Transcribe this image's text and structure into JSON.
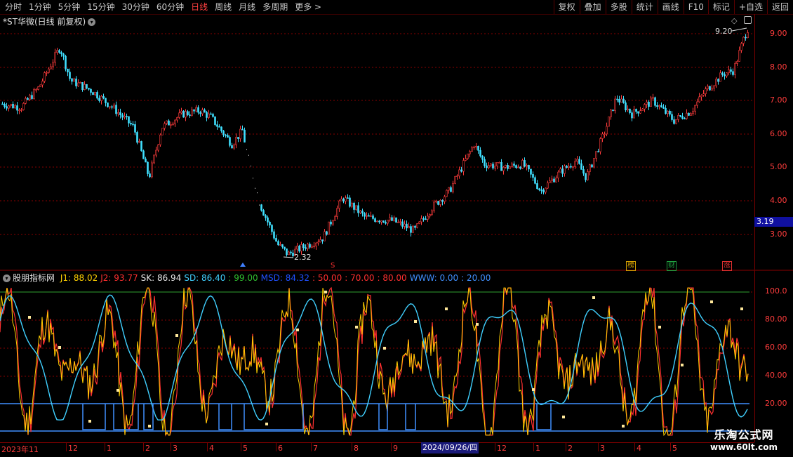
{
  "toolbar": {
    "periods": [
      "分时",
      "1分钟",
      "5分钟",
      "15分钟",
      "30分钟",
      "60分钟",
      "日线",
      "周线",
      "月线",
      "多周期",
      "更多 >"
    ],
    "active_period": "日线",
    "actions": [
      "复权",
      "叠加",
      "多股",
      "统计",
      "画线",
      "F10",
      "标记",
      "+自选",
      "返回"
    ]
  },
  "main_chart": {
    "title": "*ST华微(日线 前复权)",
    "high_label": "9.20",
    "low_label": "2.32",
    "current_price": "3.19",
    "y_ticks": [
      "9.00",
      "8.00",
      "7.00",
      "6.00",
      "5.00",
      "4.00",
      "3.00"
    ],
    "markers": [
      {
        "text": "榜",
        "color": "#d4a000"
      },
      {
        "text": "财",
        "color": "#20a040"
      },
      {
        "text": "涨",
        "color": "#e03030"
      }
    ],
    "b_marker": "S"
  },
  "indicator": {
    "name": "股朋指标网",
    "values": [
      {
        "label": "J1: 88.02",
        "color": "#ffd000"
      },
      {
        "label": "J2: 93.77",
        "color": "#ff3030"
      },
      {
        "label": "SK: 86.94",
        "color": "#e8e8e8"
      },
      {
        "label": "SD: 86.40",
        "color": "#40d0ff"
      },
      {
        "label": ": 99.00",
        "color": "#30c030"
      },
      {
        "label": "MSD: 84.32",
        "color": "#2050ff"
      },
      {
        "label": ": 50.00",
        "color": "#ff3030"
      },
      {
        "label": ": 70.00",
        "color": "#ff3030"
      },
      {
        "label": ": 80.00",
        "color": "#ff3030"
      },
      {
        "label": "WWW: 0.00",
        "color": "#4090ff"
      },
      {
        "label": ": 20.00",
        "color": "#4090ff"
      }
    ],
    "y_ticks": [
      "100.0",
      "80.00",
      "60.00",
      "40.00",
      "20.00"
    ]
  },
  "x_axis": {
    "labels": [
      "2023年11",
      "12",
      "1",
      "2",
      "3",
      "4",
      "5",
      "6",
      "7",
      "8",
      "9",
      "12",
      "1",
      "2",
      "3",
      "4",
      "5"
    ],
    "highlight": "2024/09/26/四"
  },
  "watermark": {
    "title": "乐淘公式网",
    "url": "www.60lt.com"
  },
  "colors": {
    "up": "#ff3c3c",
    "down": "#40e0ff",
    "grid": "#8a0000",
    "j1": "#ffd000",
    "j2": "#ff3030",
    "sd": "#40d0ff",
    "www": "#4090ff"
  }
}
